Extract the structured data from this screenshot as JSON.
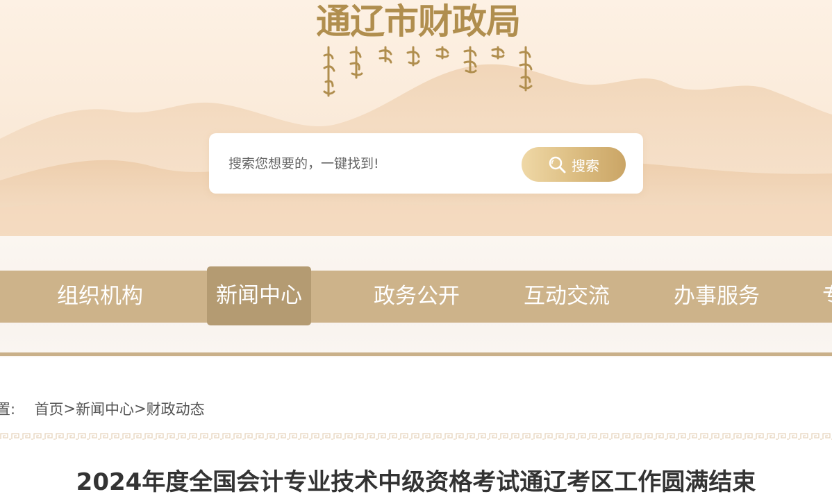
{
  "header": {
    "site_title": "通辽市财政局"
  },
  "search": {
    "placeholder": "搜索您想要的，一键找到!",
    "button_label": "搜索"
  },
  "nav": {
    "items": [
      {
        "label": "组织机构",
        "active": false
      },
      {
        "label": "新闻中心",
        "active": true
      },
      {
        "label": "政务公开",
        "active": false
      },
      {
        "label": "互动交流",
        "active": false
      },
      {
        "label": "办事服务",
        "active": false
      },
      {
        "label": "专",
        "active": false
      }
    ]
  },
  "breadcrumb": {
    "prefix": "置:",
    "items": [
      "首页",
      "新闻中心",
      "财政动态"
    ],
    "separator": ">"
  },
  "article": {
    "title": "2024年度全国会计专业技术中级资格考试通辽考区工作圆满结束"
  },
  "colors": {
    "nav_bar": "#cdb38a",
    "nav_active": "#b49b72",
    "title_gold": "#b08e4e",
    "search_button": "#d9b97c"
  }
}
